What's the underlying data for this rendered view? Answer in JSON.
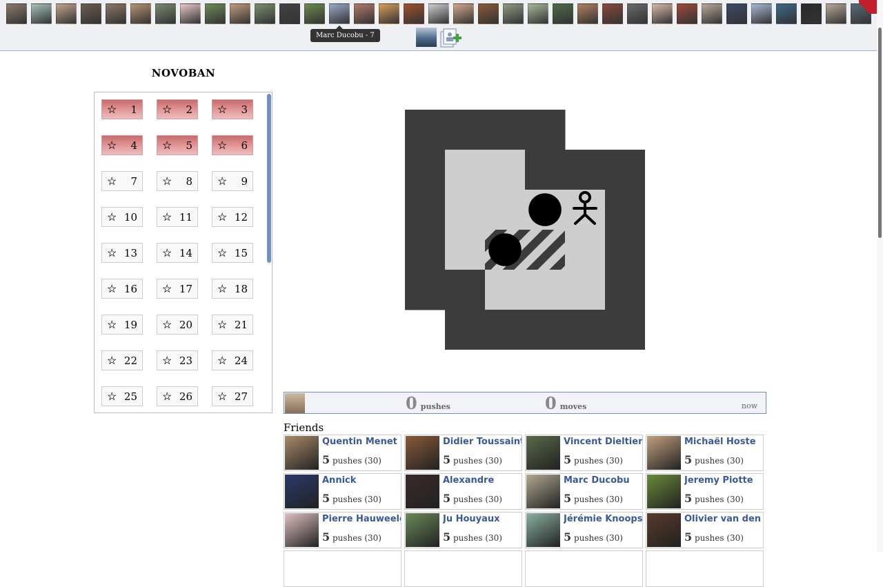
{
  "topbar": {
    "avatar_colors": [
      "#8b7a6a",
      "#a8c2b8",
      "#c2a38a",
      "#6d5d4f",
      "#8a7766",
      "#b79272",
      "#7a8a6e",
      "#e8c8c8",
      "#6f8a58",
      "#c09a7e",
      "#7b8f6c",
      "#434343",
      "#6c8a4e",
      "#9aa8c8",
      "#b07a6a",
      "#d89c5a",
      "#a0522d",
      "#cccccc",
      "#d2a88a",
      "#8a5a3a",
      "#909a80",
      "#a8b89a",
      "#4f6b4a",
      "#b08060",
      "#8a4a3a",
      "#6a6a6a",
      "#d8b8a8",
      "#a04a3a",
      "#b8a898",
      "#3a4a6a",
      "#a8b8d8",
      "#3a6a8a",
      "#2a2a2a",
      "#b8a898",
      "#5a6a7a"
    ],
    "tooltip": "Marc Ducobu - 7"
  },
  "game": {
    "title": "NOVOBAN",
    "levels": [
      {
        "n": "1",
        "done": true
      },
      {
        "n": "2",
        "done": true
      },
      {
        "n": "3",
        "done": true
      },
      {
        "n": "4",
        "done": true
      },
      {
        "n": "5",
        "done": true
      },
      {
        "n": "6",
        "done": true
      },
      {
        "n": "7",
        "done": false
      },
      {
        "n": "8",
        "done": false
      },
      {
        "n": "9",
        "done": false
      },
      {
        "n": "10",
        "done": false
      },
      {
        "n": "11",
        "done": false
      },
      {
        "n": "12",
        "done": false
      },
      {
        "n": "13",
        "done": false
      },
      {
        "n": "14",
        "done": false
      },
      {
        "n": "15",
        "done": false
      },
      {
        "n": "16",
        "done": false
      },
      {
        "n": "17",
        "done": false
      },
      {
        "n": "18",
        "done": false
      },
      {
        "n": "19",
        "done": false
      },
      {
        "n": "20",
        "done": false
      },
      {
        "n": "21",
        "done": false
      },
      {
        "n": "22",
        "done": false
      },
      {
        "n": "23",
        "done": false
      },
      {
        "n": "24",
        "done": false
      },
      {
        "n": "25",
        "done": false
      },
      {
        "n": "26",
        "done": false
      },
      {
        "n": "27",
        "done": false
      }
    ],
    "board": {
      "rows": 6,
      "cols": 6,
      "wall_color": "#3c3c3c",
      "floor_color": "#cdcdcd",
      "layout": [
        "WWWW..",
        "WFFWWW",
        "WFFFFW",
        "WFTTFW",
        "WWFFFW",
        ".WWWWW"
      ],
      "boxes": [
        [
          2,
          3
        ],
        [
          3,
          2
        ]
      ],
      "player": [
        2,
        4
      ]
    },
    "stats": {
      "pushes": "0",
      "pushes_label": "pushes",
      "moves": "0",
      "moves_label": "moves",
      "time": "now"
    }
  },
  "friends": {
    "title": "Friends",
    "list": [
      {
        "name": "Quentin Menet",
        "score": "5",
        "label": "pushes (30)",
        "color": "#a88a6a"
      },
      {
        "name": "Didier Toussaint",
        "score": "5",
        "label": "pushes (30)",
        "color": "#8a5a3a"
      },
      {
        "name": "Vincent Dieltiens",
        "score": "5",
        "label": "pushes (30)",
        "color": "#5a6a4a"
      },
      {
        "name": "Michaël Hoste",
        "score": "5",
        "label": "pushes (30)",
        "color": "#c0a080"
      },
      {
        "name": "Annick",
        "score": "5",
        "label": "pushes (30)",
        "color": "#2a3a6a"
      },
      {
        "name": "Alexandre",
        "score": "5",
        "label": "pushes (30)",
        "color": "#3a2a2a"
      },
      {
        "name": "Marc Ducobu",
        "score": "5",
        "label": "pushes (30)",
        "color": "#b0a890"
      },
      {
        "name": "Jeremy Piotte",
        "score": "5",
        "label": "pushes (30)",
        "color": "#6a8a3a"
      },
      {
        "name": "Pierre Hauweele",
        "score": "5",
        "label": "pushes (30)",
        "color": "#e0c0c0"
      },
      {
        "name": "Ju Houyaux",
        "score": "5",
        "label": "pushes (30)",
        "color": "#6a8a5a"
      },
      {
        "name": "Jérémie Knoops",
        "score": "5",
        "label": "pushes (30)",
        "color": "#8ab0a0"
      },
      {
        "name": "Olivier van den",
        "score": "5",
        "label": "pushes (30)",
        "color": "#5a3a2a"
      }
    ]
  }
}
